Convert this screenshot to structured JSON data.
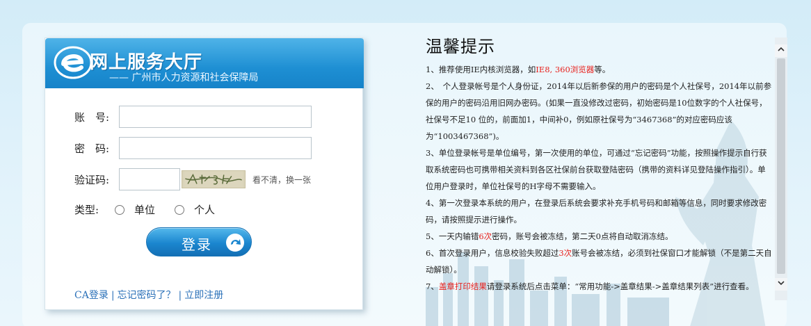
{
  "header": {
    "title": "网上服务大厅",
    "subtitle": "—— 广州市人力资源和社会保障局"
  },
  "form": {
    "account_label": "账　号:",
    "password_label": "密　码:",
    "captcha_label": "验证码:",
    "type_label": "类型:",
    "captcha_refresh": "看不清，换一张",
    "type_options": [
      "单位",
      "个人"
    ],
    "account_value": "",
    "password_value": "",
    "captcha_value": "",
    "login_button": "登录"
  },
  "links": {
    "ca_login": "CA登录",
    "forgot": "忘记密码了？",
    "register": "立即注册"
  },
  "notice": {
    "title": "温馨提示",
    "items": [
      {
        "parts": [
          {
            "t": "1、推荐使用IE内核浏览器，如"
          },
          {
            "t": "IE8, 360浏览器",
            "red": true
          },
          {
            "t": "等。"
          }
        ]
      },
      {
        "parts": [
          {
            "t": "2、　个人登录帐号是个人身份证，2014年以后新参保的用户的密码是个人社保号，2014年以前参保的用户的密码沿用旧网办密码。(如果一直没修改过密码，初始密码是10位数字的个人社保号，社保号不足10 位的，前面加1，中间补0，例如原社保号为“3467368”的对应密码应该为“1003467368”)。"
          }
        ]
      },
      {
        "parts": [
          {
            "t": "3、单位登录帐号是单位编号，第一次使用的单位，可通过“忘记密码”功能，按照操作提示自行获取系统密码也可携带相关资料到各区社保前台获取登陆密码（携带的资料详见登陆操作指引）。单位用户登录时，单位社保号的H字母不需要输入。"
          }
        ]
      },
      {
        "parts": [
          {
            "t": "4、第一次登录本系统的用户，在登录后系统会要求补充手机号码和邮箱等信息，同时要求修改密码，请按照提示进行操作。"
          }
        ]
      },
      {
        "parts": [
          {
            "t": "5、一天内输错"
          },
          {
            "t": "6次",
            "red": true
          },
          {
            "t": "密码，账号会被冻结，第二天0点将自动取消冻结。"
          }
        ]
      },
      {
        "parts": [
          {
            "t": "6、首次登录用户，信息校验失败超过"
          },
          {
            "t": "3次",
            "red": true
          },
          {
            "t": "账号会被冻结，必须到社保窗口才能解锁（不是第二天自动解锁）。"
          }
        ]
      },
      {
        "parts": [
          {
            "t": "7、"
          },
          {
            "t": "盖章打印结果",
            "red": true
          },
          {
            "t": "请登录系统后点击菜单：“常用功能->盖章结果->盖章结果列表”进行查看。"
          }
        ]
      }
    ]
  },
  "scrollbar": {
    "up_icon": "chevron-up-icon",
    "down_icon": "chevron-down-icon"
  }
}
